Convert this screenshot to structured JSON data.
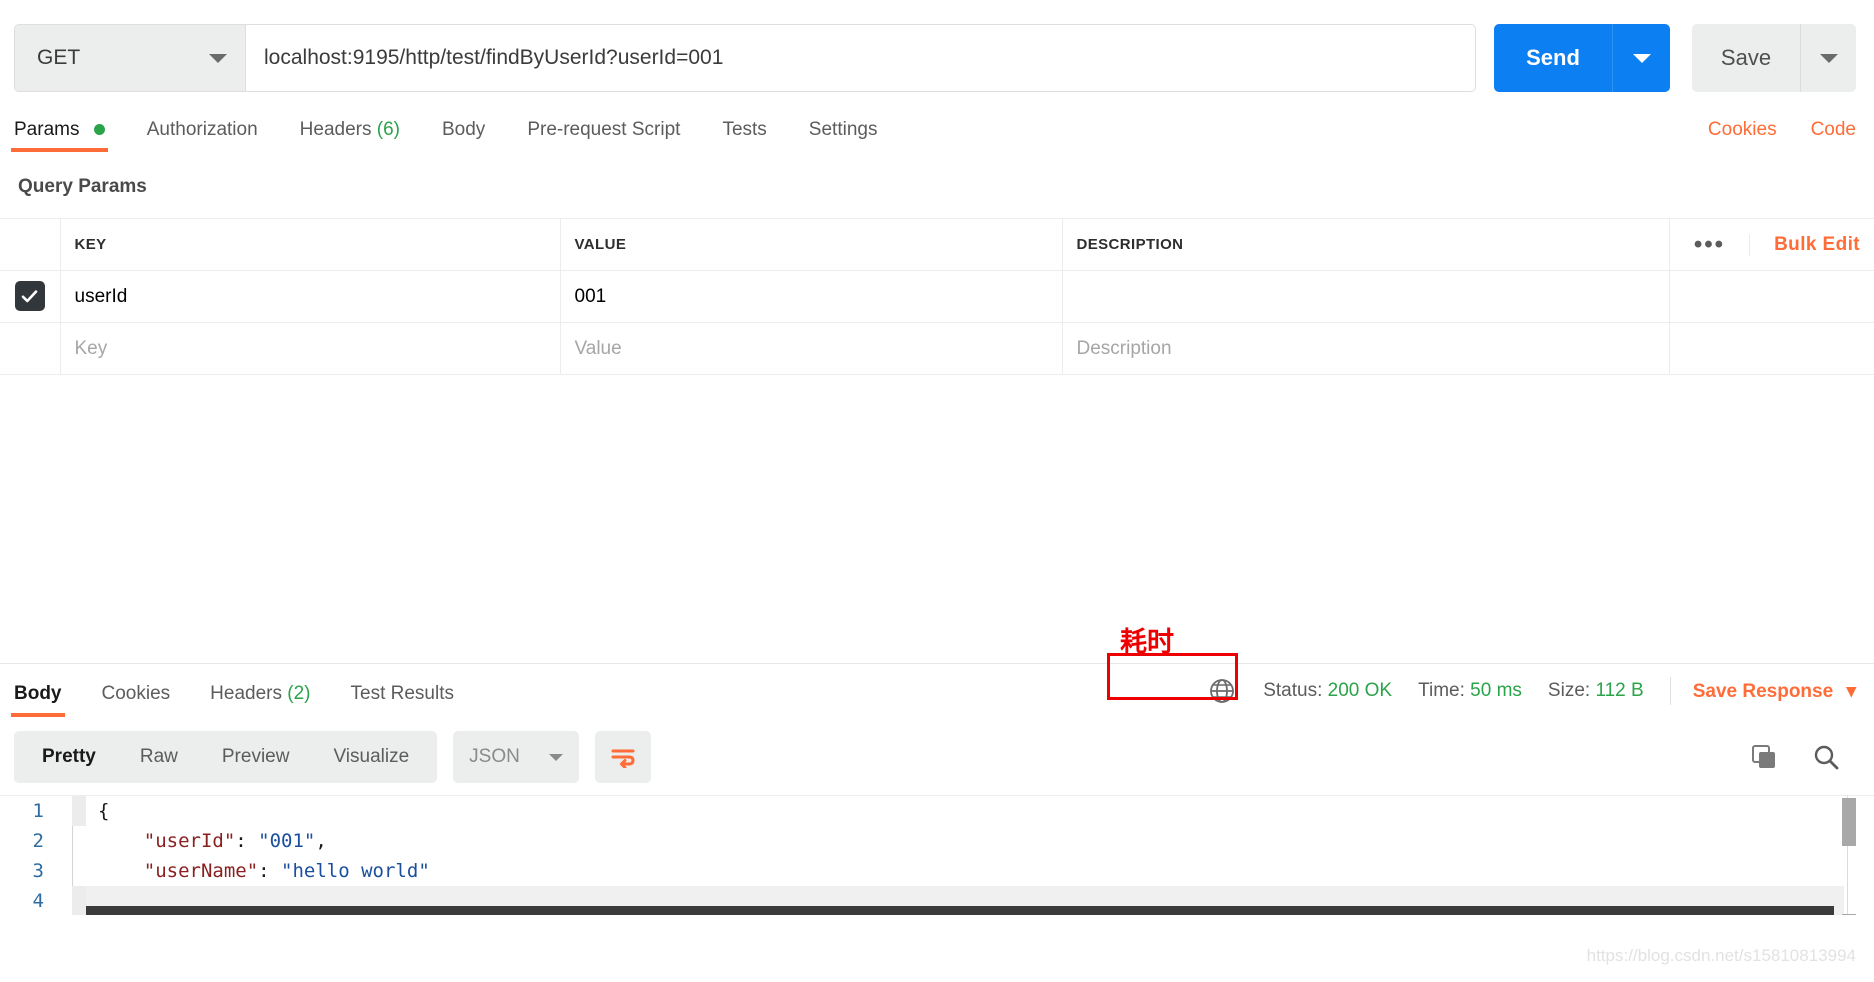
{
  "request": {
    "method": "GET",
    "url": "localhost:9195/http/test/findByUserId?userId=001",
    "send_label": "Send",
    "save_label": "Save"
  },
  "request_tabs": [
    {
      "label": "Params",
      "badge": "",
      "dot": true,
      "active": true
    },
    {
      "label": "Authorization",
      "badge": "",
      "dot": false,
      "active": false
    },
    {
      "label": "Headers",
      "badge": "(6)",
      "dot": false,
      "active": false
    },
    {
      "label": "Body",
      "badge": "",
      "dot": false,
      "active": false
    },
    {
      "label": "Pre-request Script",
      "badge": "",
      "dot": false,
      "active": false
    },
    {
      "label": "Tests",
      "badge": "",
      "dot": false,
      "active": false
    },
    {
      "label": "Settings",
      "badge": "",
      "dot": false,
      "active": false
    }
  ],
  "tabs_right": {
    "cookies": "Cookies",
    "code": "Code"
  },
  "query_params": {
    "title": "Query Params",
    "headers": {
      "key": "KEY",
      "value": "VALUE",
      "description": "DESCRIPTION",
      "more": "•••",
      "bulk_edit": "Bulk Edit"
    },
    "rows": [
      {
        "checked": true,
        "key": "userId",
        "value": "001",
        "description": ""
      }
    ],
    "placeholder_row": {
      "key": "Key",
      "value": "Value",
      "description": "Description"
    }
  },
  "annotation": {
    "text": "耗时",
    "color": "#ee0000"
  },
  "response_tabs": [
    {
      "label": "Body",
      "badge": "",
      "active": true
    },
    {
      "label": "Cookies",
      "badge": "",
      "active": false
    },
    {
      "label": "Headers",
      "badge": "(2)",
      "active": false
    },
    {
      "label": "Test Results",
      "badge": "",
      "active": false
    }
  ],
  "response_meta": {
    "status_label": "Status:",
    "status_value": "200 OK",
    "time_label": "Time:",
    "time_value": "50 ms",
    "size_label": "Size:",
    "size_value": "112 B",
    "save_response": "Save Response"
  },
  "body_toolbar": {
    "views": [
      {
        "label": "Pretty",
        "active": true
      },
      {
        "label": "Raw",
        "active": false
      },
      {
        "label": "Preview",
        "active": false
      },
      {
        "label": "Visualize",
        "active": false
      }
    ],
    "format": "JSON"
  },
  "response_body": {
    "lines": [
      {
        "n": "1",
        "segments": [
          {
            "t": "{",
            "c": "p"
          }
        ]
      },
      {
        "n": "2",
        "segments": [
          {
            "t": "    ",
            "c": "p"
          },
          {
            "t": "\"userId\"",
            "c": "k"
          },
          {
            "t": ": ",
            "c": "p"
          },
          {
            "t": "\"001\"",
            "c": "s"
          },
          {
            "t": ",",
            "c": "p"
          }
        ]
      },
      {
        "n": "3",
        "segments": [
          {
            "t": "    ",
            "c": "p"
          },
          {
            "t": "\"userName\"",
            "c": "k"
          },
          {
            "t": ": ",
            "c": "p"
          },
          {
            "t": "\"hello world\"",
            "c": "s"
          }
        ]
      },
      {
        "n": "4",
        "segments": [
          {
            "t": "}",
            "c": "p"
          }
        ]
      }
    ]
  },
  "watermark": "https://blog.csdn.net/s15810813994",
  "colors": {
    "accent": "#ff6c37",
    "send_blue": "#0c7ff2",
    "success_green": "#2aa34a",
    "annotation_red": "#ee0000"
  }
}
